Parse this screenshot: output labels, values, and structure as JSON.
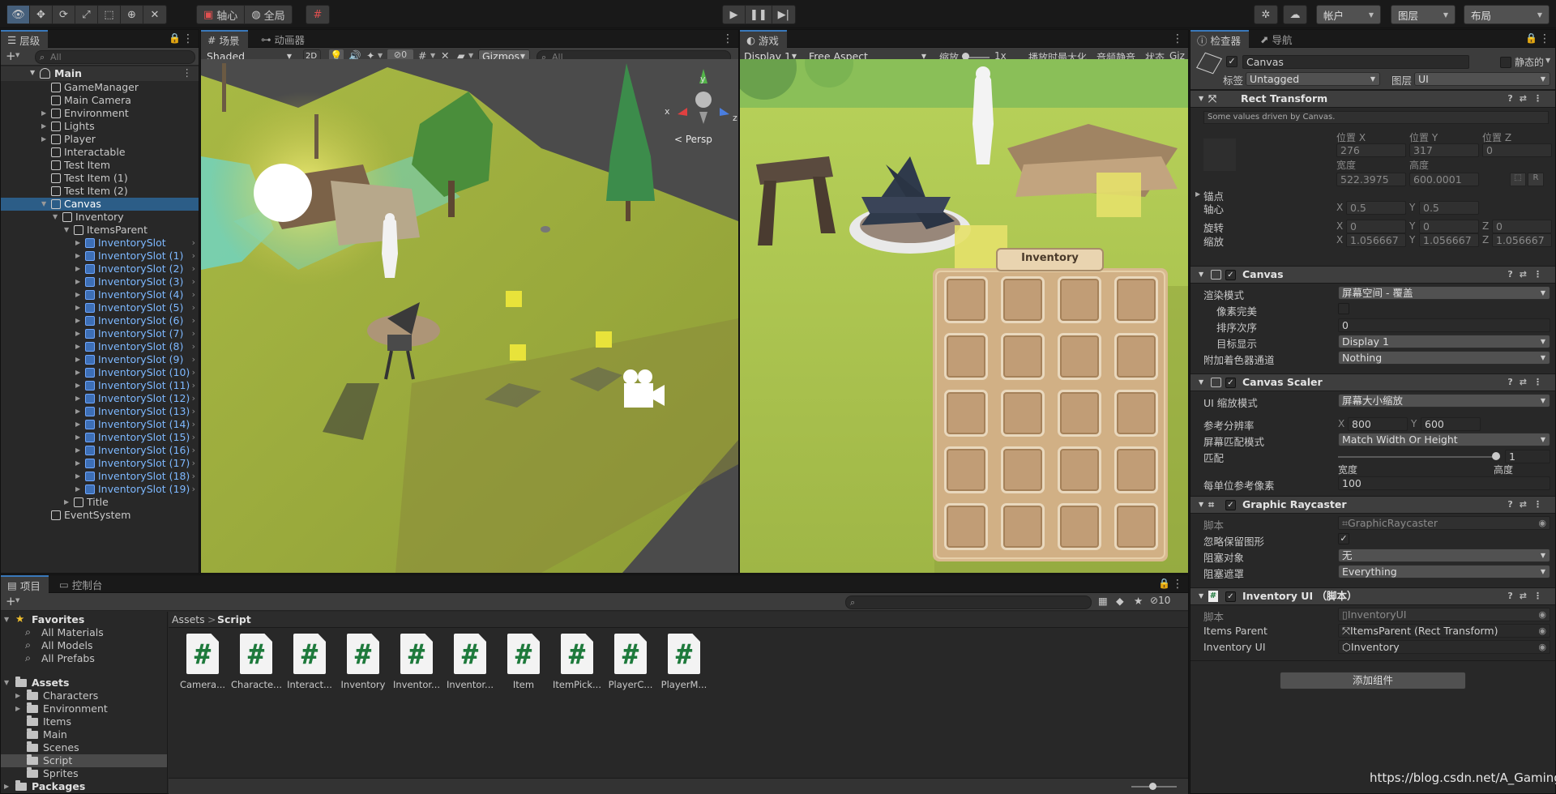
{
  "toolbar": {
    "pivot_label": "轴心",
    "global_label": "全局",
    "account_label": "帐户",
    "layers_label": "图层",
    "layout_label": "布局"
  },
  "hierarchy": {
    "tab_label": "层级",
    "search_placeholder": "All",
    "scene_name": "Main",
    "items": [
      {
        "label": "GameManager",
        "depth": 1,
        "arrow": "",
        "style": "normal"
      },
      {
        "label": "Main Camera",
        "depth": 1,
        "arrow": "",
        "style": "normal"
      },
      {
        "label": "Environment",
        "depth": 1,
        "arrow": "▶",
        "style": "normal"
      },
      {
        "label": "Lights",
        "depth": 1,
        "arrow": "▶",
        "style": "normal"
      },
      {
        "label": "Player",
        "depth": 1,
        "arrow": "▶",
        "style": "normal"
      },
      {
        "label": "Interactable",
        "depth": 1,
        "arrow": "",
        "style": "normal"
      },
      {
        "label": "Test Item",
        "depth": 1,
        "arrow": "",
        "style": "normal"
      },
      {
        "label": "Test Item (1)",
        "depth": 1,
        "arrow": "",
        "style": "normal"
      },
      {
        "label": "Test Item (2)",
        "depth": 1,
        "arrow": "",
        "style": "normal"
      },
      {
        "label": "Canvas",
        "depth": 1,
        "arrow": "▼",
        "style": "selected"
      },
      {
        "label": "Inventory",
        "depth": 2,
        "arrow": "▼",
        "style": "normal"
      },
      {
        "label": "ItemsParent",
        "depth": 3,
        "arrow": "▼",
        "style": "normal"
      },
      {
        "label": "InventorySlot",
        "depth": 4,
        "arrow": "▶",
        "style": "prefab"
      },
      {
        "label": "InventorySlot (1)",
        "depth": 4,
        "arrow": "▶",
        "style": "prefab"
      },
      {
        "label": "InventorySlot (2)",
        "depth": 4,
        "arrow": "▶",
        "style": "prefab"
      },
      {
        "label": "InventorySlot (3)",
        "depth": 4,
        "arrow": "▶",
        "style": "prefab"
      },
      {
        "label": "InventorySlot (4)",
        "depth": 4,
        "arrow": "▶",
        "style": "prefab"
      },
      {
        "label": "InventorySlot (5)",
        "depth": 4,
        "arrow": "▶",
        "style": "prefab"
      },
      {
        "label": "InventorySlot (6)",
        "depth": 4,
        "arrow": "▶",
        "style": "prefab"
      },
      {
        "label": "InventorySlot (7)",
        "depth": 4,
        "arrow": "▶",
        "style": "prefab"
      },
      {
        "label": "InventorySlot (8)",
        "depth": 4,
        "arrow": "▶",
        "style": "prefab"
      },
      {
        "label": "InventorySlot (9)",
        "depth": 4,
        "arrow": "▶",
        "style": "prefab"
      },
      {
        "label": "InventorySlot (10)",
        "depth": 4,
        "arrow": "▶",
        "style": "prefab"
      },
      {
        "label": "InventorySlot (11)",
        "depth": 4,
        "arrow": "▶",
        "style": "prefab"
      },
      {
        "label": "InventorySlot (12)",
        "depth": 4,
        "arrow": "▶",
        "style": "prefab"
      },
      {
        "label": "InventorySlot (13)",
        "depth": 4,
        "arrow": "▶",
        "style": "prefab"
      },
      {
        "label": "InventorySlot (14)",
        "depth": 4,
        "arrow": "▶",
        "style": "prefab"
      },
      {
        "label": "InventorySlot (15)",
        "depth": 4,
        "arrow": "▶",
        "style": "prefab"
      },
      {
        "label": "InventorySlot (16)",
        "depth": 4,
        "arrow": "▶",
        "style": "prefab"
      },
      {
        "label": "InventorySlot (17)",
        "depth": 4,
        "arrow": "▶",
        "style": "prefab"
      },
      {
        "label": "InventorySlot (18)",
        "depth": 4,
        "arrow": "▶",
        "style": "prefab"
      },
      {
        "label": "InventorySlot (19)",
        "depth": 4,
        "arrow": "▶",
        "style": "prefab"
      },
      {
        "label": "Title",
        "depth": 3,
        "arrow": "▶",
        "style": "normal"
      },
      {
        "label": "EventSystem",
        "depth": 1,
        "arrow": "",
        "style": "normal"
      }
    ]
  },
  "scene": {
    "tab_label": "场景",
    "animator_tab_label": "动画器",
    "shading_mode": "Shaded",
    "mode_2d": "2D",
    "hidden_count": "0",
    "gizmos_label": "Gizmos",
    "search_placeholder": "All",
    "persp_label": "< Persp",
    "axis_y": "y",
    "axis_x": "x",
    "axis_z": "z"
  },
  "game": {
    "tab_label": "游戏",
    "display": "Display 1",
    "aspect": "Free Aspect",
    "scale_label": "缩放",
    "scale_value": "1x",
    "maximize_label": "播放时最大化",
    "mute_label": "音频静音",
    "stats_label": "状态",
    "gizmos_label": "Giz",
    "inventory_title": "Inventory"
  },
  "inspector": {
    "tab_label": "检查器",
    "nav_tab_label": "导航",
    "object_name": "Canvas",
    "static_label": "静态的",
    "tag_label": "标签",
    "tag_value": "Untagged",
    "layer_label": "图层",
    "layer_value": "UI",
    "rect_transform": {
      "title": "Rect Transform",
      "note": "Some values driven by Canvas.",
      "pos_x_label": "位置 X",
      "pos_y_label": "位置 Y",
      "pos_z_label": "位置 Z",
      "pos_x": "276",
      "pos_y": "317",
      "pos_z": "0",
      "width_label": "宽度",
      "height_label": "高度",
      "width": "522.3975",
      "height": "600.0001",
      "r_button": "R",
      "anchors_label": "锚点",
      "pivot_label": "轴心",
      "pivot_x": "0.5",
      "pivot_y": "0.5",
      "rotation_label": "旋转",
      "rot_x": "0",
      "rot_y": "0",
      "rot_z": "0",
      "scale_label": "缩放",
      "scale_x": "1.056667",
      "scale_y": "1.056667",
      "scale_z": "1.056667",
      "x": "X",
      "y": "Y",
      "z": "Z"
    },
    "canvas": {
      "title": "Canvas",
      "render_mode_label": "渲染模式",
      "render_mode": "屏幕空间 - 覆盖",
      "pixel_perfect_label": "像素完美",
      "sort_order_label": "排序次序",
      "sort_order": "0",
      "target_display_label": "目标显示",
      "target_display": "Display 1",
      "shader_channels_label": "附加着色器通道",
      "shader_channels": "Nothing"
    },
    "canvas_scaler": {
      "title": "Canvas Scaler",
      "scale_mode_label": "UI 缩放模式",
      "scale_mode": "屏幕大小缩放",
      "ref_res_label": "参考分辨率",
      "ref_x": "800",
      "ref_y": "600",
      "match_mode_label": "屏幕匹配模式",
      "match_mode": "Match Width Or Height",
      "match_label": "匹配",
      "match_value": "1",
      "match_fraction": 1,
      "width_label": "宽度",
      "height_label": "高度",
      "ppu_label": "每单位参考像素",
      "ppu": "100"
    },
    "graphic_raycaster": {
      "title": "Graphic Raycaster",
      "script_label": "脚本",
      "script_value": "GraphicRaycaster",
      "ignore_reversed_label": "忽略保留图形",
      "blocking_objects_label": "阻塞对象",
      "blocking_objects": "无",
      "blocking_mask_label": "阻塞遮罩",
      "blocking_mask": "Everything"
    },
    "inventory_ui": {
      "title": "Inventory UI （脚本）",
      "script_label": "脚本",
      "script_value": "InventoryUI",
      "items_parent_label": "Items Parent",
      "items_parent_value": "ItemsParent (Rect Transform)",
      "inventory_ui_label": "Inventory UI",
      "inventory_ui_value": "Inventory"
    },
    "add_component": "添加组件"
  },
  "project": {
    "tab_label": "项目",
    "console_tab_label": "控制台",
    "hidden_count": "10",
    "breadcrumb_root": "Assets",
    "breadcrumb_sep": ">",
    "breadcrumb_current": "Script",
    "favorites_label": "Favorites",
    "favorites": [
      "All Materials",
      "All Models",
      "All Prefabs"
    ],
    "assets_label": "Assets",
    "folders": [
      "Characters",
      "Environment",
      "Items",
      "Main",
      "Scenes",
      "Script",
      "Sprites"
    ],
    "packages_label": "Packages",
    "files": [
      "Camera...",
      "Characte...",
      "Interact...",
      "Inventory",
      "Inventor...",
      "Inventor...",
      "Item",
      "ItemPick...",
      "PlayerC...",
      "PlayerM..."
    ]
  },
  "watermark": "https://blog.csdn.net/A_Gaming",
  "colors": {
    "accent_blue": "#3a79bb",
    "selection": "#2c5d87",
    "prefab_blue": "#7db8ff",
    "script_green": "#1e7a3c"
  }
}
